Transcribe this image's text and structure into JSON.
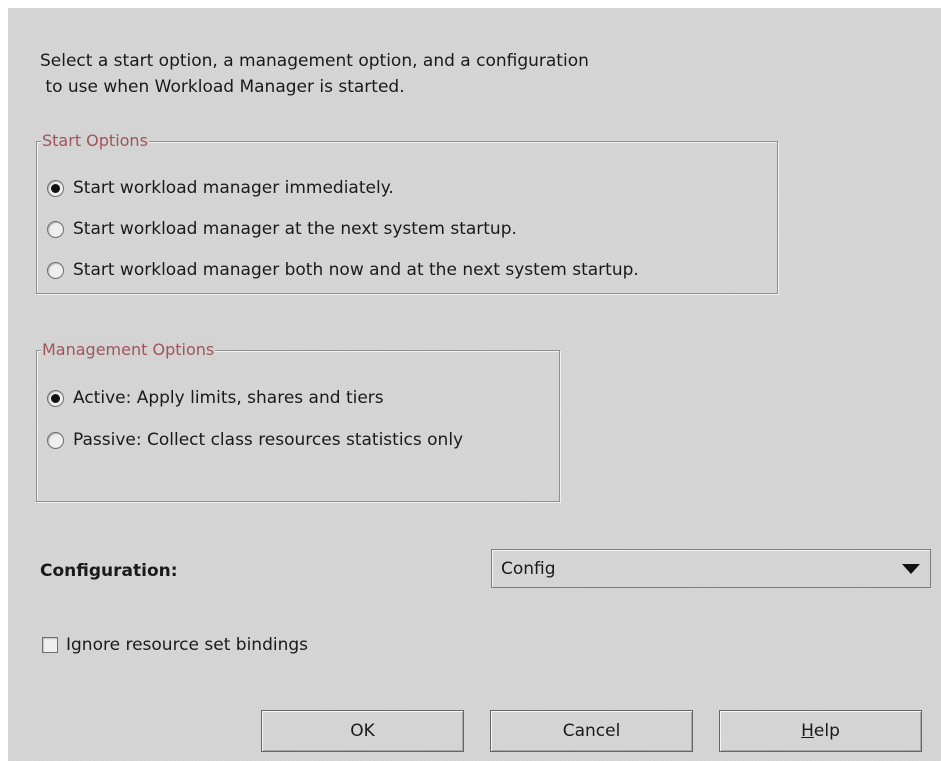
{
  "intro": {
    "line1": "Select a start option, a management option, and a configuration",
    "line2": " to use when Workload Manager is started."
  },
  "start_options": {
    "title": "Start Options",
    "options": [
      {
        "label": "Start workload manager immediately.",
        "checked": true
      },
      {
        "label": "Start workload manager at the next system startup.",
        "checked": false
      },
      {
        "label": "Start workload manager both now and at the next system startup.",
        "checked": false
      }
    ]
  },
  "management_options": {
    "title": "Management Options",
    "options": [
      {
        "label": "Active: Apply limits, shares and tiers",
        "checked": true
      },
      {
        "label": "Passive: Collect class resources statistics only",
        "checked": false
      }
    ]
  },
  "configuration": {
    "label": "Configuration:",
    "selected": "Config"
  },
  "ignore_bindings": {
    "label": "Ignore resource set bindings",
    "checked": false
  },
  "buttons": {
    "ok": "OK",
    "cancel": "Cancel",
    "help_mnemonic": "H",
    "help_rest": "elp"
  },
  "colors": {
    "dialog_bg": "#d3d3d3",
    "group_title": "#a0545a"
  }
}
